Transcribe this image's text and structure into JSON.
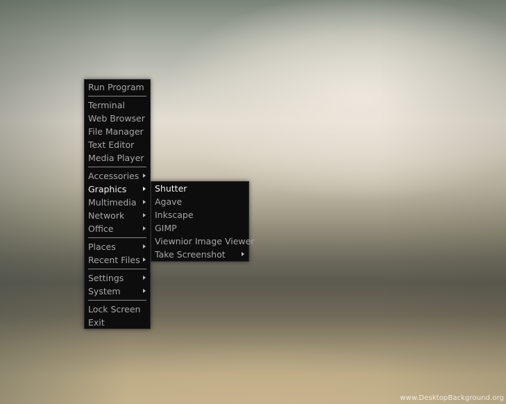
{
  "main_menu": {
    "run_program": "Run Program",
    "terminal": "Terminal",
    "web_browser": "Web Browser",
    "file_manager": "File Manager",
    "text_editor": "Text Editor",
    "media_player": "Media Player",
    "accessories": "Accessories",
    "graphics": "Graphics",
    "multimedia": "Multimedia",
    "network": "Network",
    "office": "Office",
    "places": "Places",
    "recent_files": "Recent Files",
    "settings": "Settings",
    "system": "System",
    "lock_screen": "Lock Screen",
    "exit": "Exit"
  },
  "graphics_submenu": {
    "shutter": "Shutter",
    "agave": "Agave",
    "inkscape": "Inkscape",
    "gimp": "GIMP",
    "viewnior": "Viewnior Image Viewer",
    "take_screenshot": "Take Screenshot"
  },
  "watermark": "www.DesktopBackground.org",
  "colors": {
    "menu_background": "#0d0d0d",
    "menu_text": "#a7a7a7",
    "menu_text_active": "#f2f2f2",
    "separator": "#8a8a8a"
  }
}
